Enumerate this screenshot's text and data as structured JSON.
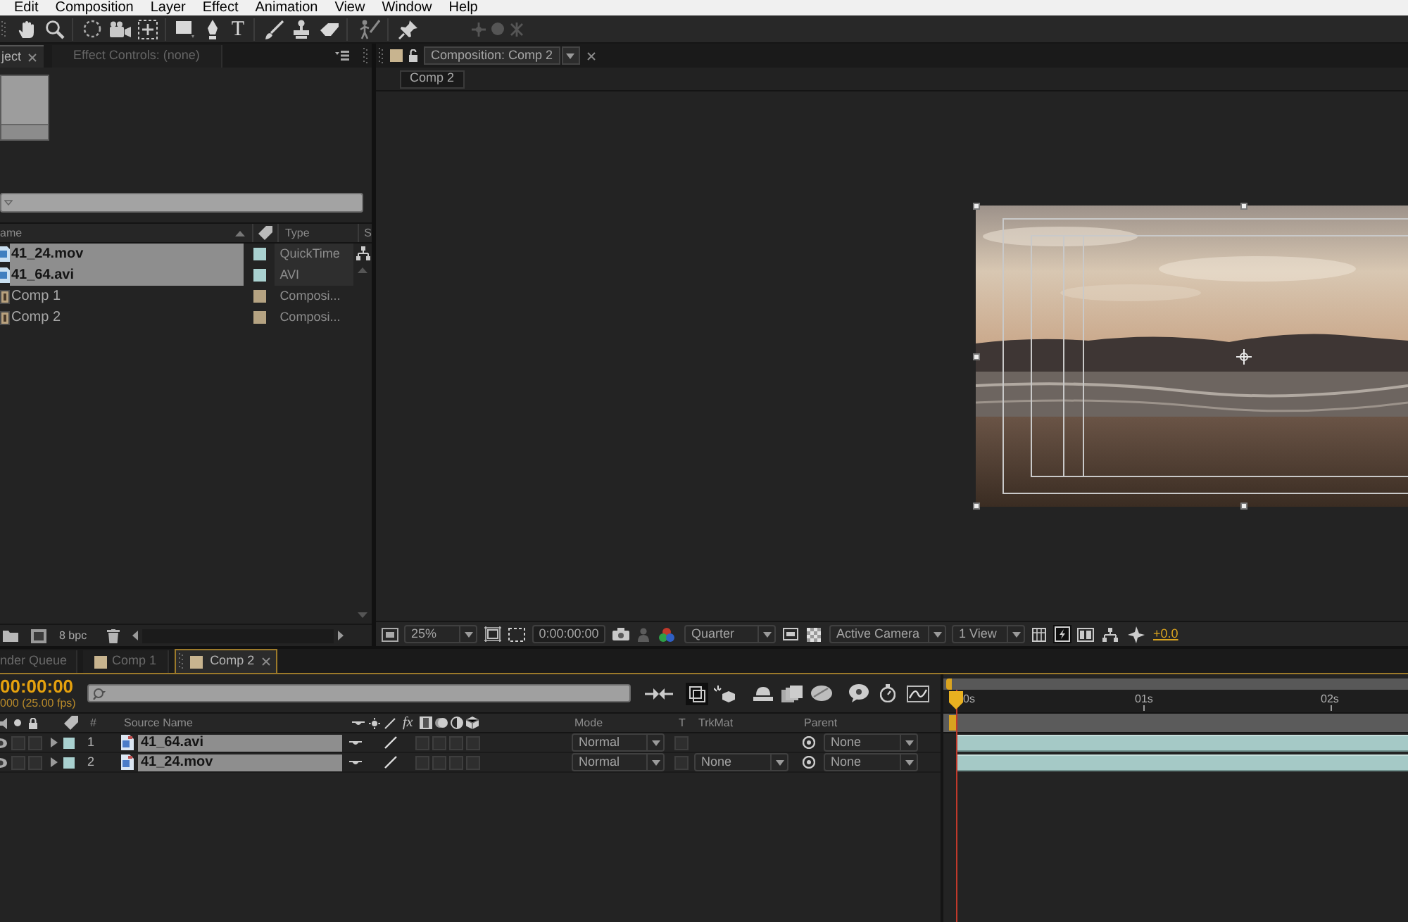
{
  "menu_bar": {
    "items": [
      "Edit",
      "Composition",
      "Layer",
      "Effect",
      "Animation",
      "View",
      "Window",
      "Help"
    ]
  },
  "toolbar": {
    "type_tool": "T"
  },
  "project_panel": {
    "tabs": [
      {
        "label": "ject",
        "selected": true
      },
      {
        "label": "Effect Controls: (none)",
        "selected": false
      }
    ],
    "columns": {
      "name": "ame",
      "type": "Type",
      "column_3": "S"
    },
    "items": [
      {
        "kind": "footage",
        "name": "41_24.mov",
        "type": "QuickTime",
        "color": "#a9d1d0",
        "selected": true
      },
      {
        "kind": "footage",
        "name": "41_64.avi",
        "type": "AVI",
        "color": "#a9d1d0",
        "selected": true
      },
      {
        "kind": "composition",
        "name": "Comp 1",
        "type": "Composi...",
        "color": "#b5a382",
        "selected": false
      },
      {
        "kind": "composition",
        "name": "Comp 2",
        "type": "Composi...",
        "color": "#b5a382",
        "selected": false
      }
    ],
    "bit_depth": "8 bpc"
  },
  "composition_panel": {
    "tab": "Composition: Comp 2",
    "breadcrumb": "Comp 2",
    "zoom": "25%",
    "timecode": "0:00:00:00",
    "resolution": "Quarter",
    "camera": "Active Camera",
    "view_layout": "1 View",
    "exposure": "+0.0"
  },
  "timeline": {
    "tabs": [
      {
        "label": "nder Queue",
        "kind": "render_queue",
        "selected": false
      },
      {
        "label": "Comp 1",
        "kind": "composition",
        "selected": false
      },
      {
        "label": "Comp 2",
        "kind": "composition",
        "selected": true
      }
    ],
    "timecode": "00:00:00",
    "frame_rate": "000 (25.00 fps)",
    "columns": {
      "number": "#",
      "source_name": "Source Name",
      "effects": "fx",
      "mode": "Mode",
      "track_matte_toggle": "T",
      "track_matte": "TrkMat",
      "parent": "Parent"
    },
    "layers": [
      {
        "number": "1",
        "name": "41_64.avi",
        "selected": true,
        "solo": false,
        "locked": false,
        "frame_blending": false,
        "motion_blur": false,
        "adjustment_layer": false,
        "three_d": false,
        "mode": "Normal",
        "preserve_transparency": false,
        "parent": "None"
      },
      {
        "number": "2",
        "name": "41_24.mov",
        "selected": true,
        "solo": false,
        "locked": false,
        "frame_blending": false,
        "motion_blur": false,
        "adjustment_layer": false,
        "three_d": false,
        "mode": "Normal",
        "preserve_transparency": false,
        "track_matte": "None",
        "parent": "None"
      }
    ],
    "ruler": [
      "0s",
      "01s",
      "02s"
    ]
  }
}
